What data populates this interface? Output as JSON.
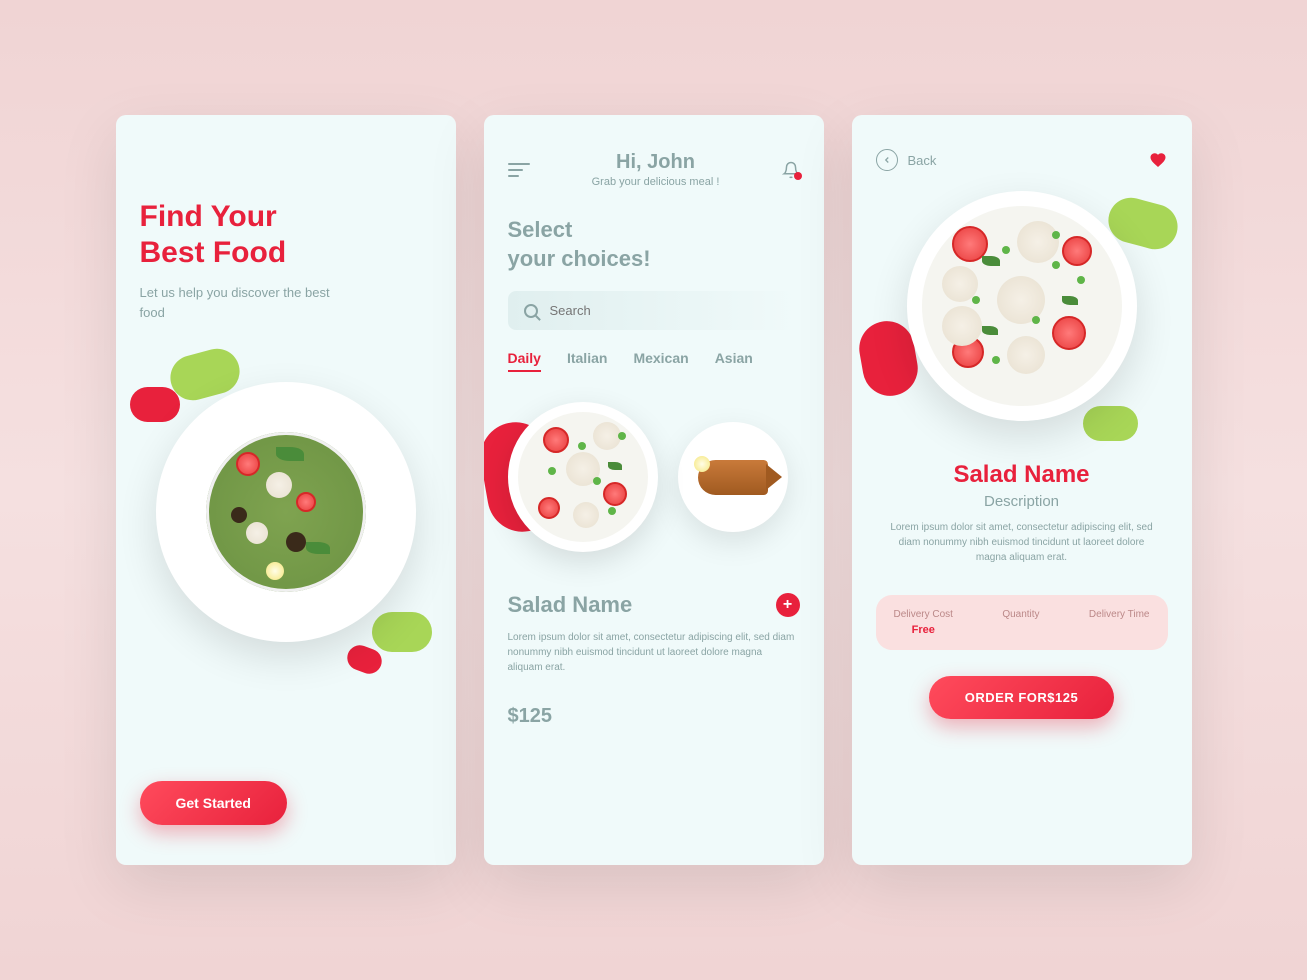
{
  "colors": {
    "accent": "#e8213c",
    "green": "#a8d657",
    "muted": "#8aa4a4"
  },
  "screen1": {
    "title_line1": "Find Your",
    "title_line2": "Best Food",
    "subtitle": "Let us help you discover the best food",
    "cta": "Get Started"
  },
  "screen2": {
    "greeting": "Hi, John",
    "greeting_sub": "Grab your delicious meal !",
    "select_line1": "Select",
    "select_line2": "your choices!",
    "search_placeholder": "Search",
    "tabs": [
      "Daily",
      "Italian",
      "Mexican",
      "Asian"
    ],
    "active_tab": 0,
    "item_name": "Salad Name",
    "item_desc": "Lorem ipsum dolor sit amet, consectetur adipiscing elit, sed diam nonummy nibh euismod tincidunt ut laoreet dolore magna aliquam erat.",
    "price": "$125"
  },
  "screen3": {
    "back_label": "Back",
    "title": "Salad Name",
    "desc_label": "Description",
    "desc_text": "Lorem ipsum dolor sit amet, consectetur adipiscing elit, sed diam nonummy nibh euismod tincidunt ut laoreet dolore magna aliquam erat.",
    "info": {
      "delivery_cost_label": "Delivery Cost",
      "delivery_cost_value": "Free",
      "quantity_label": "Quantity",
      "quantity_value": "",
      "delivery_time_label": "Delivery Time",
      "delivery_time_value": ""
    },
    "order_label": "ORDER FOR$125"
  }
}
